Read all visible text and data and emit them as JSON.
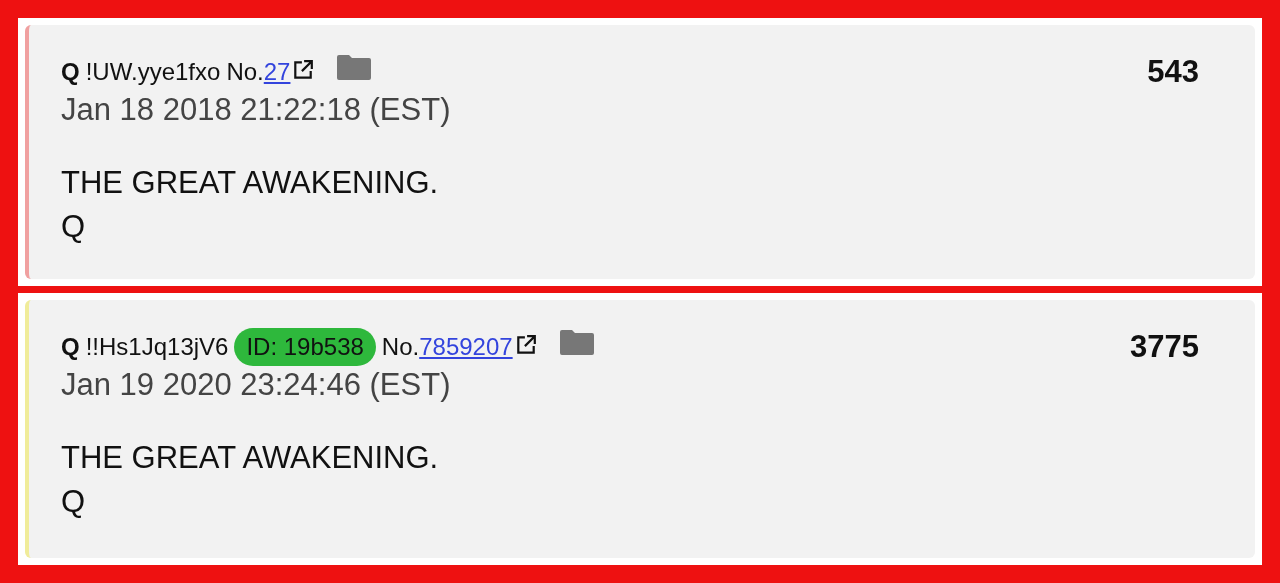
{
  "posts": [
    {
      "name": "Q",
      "tripcode": "!UW.yye1fxo",
      "no_label": "No.",
      "post_number": "27",
      "date": "Jan 18 2018 21:22:18 (EST)",
      "body": [
        "THE GREAT AWAKENING.",
        "Q"
      ],
      "count": "543",
      "color": "#f0a0a0"
    },
    {
      "name": "Q",
      "tripcode": "!!Hs1Jq13jV6",
      "id_badge": {
        "label": "ID: 19b538",
        "color": "#2eb83c"
      },
      "no_label": "No.",
      "post_number": "7859207",
      "date": "Jan 19 2020 23:24:46 (EST)",
      "body": [
        "THE GREAT AWAKENING.",
        "Q"
      ],
      "count": "3775",
      "color": "#f0ec9a"
    }
  ]
}
